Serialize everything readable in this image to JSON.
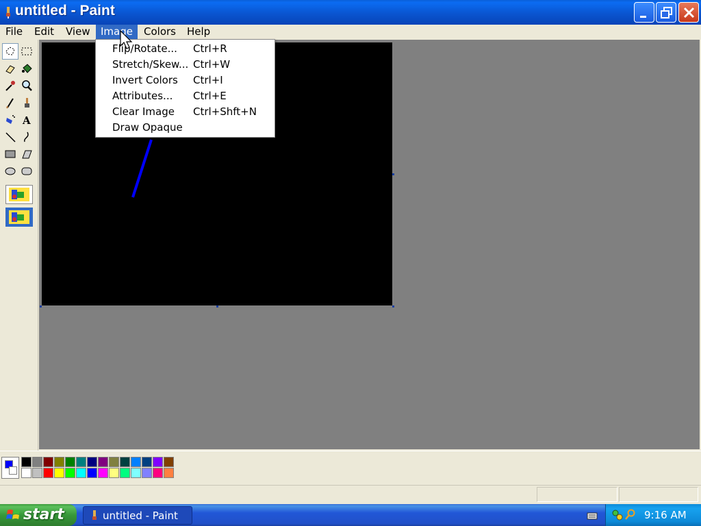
{
  "window": {
    "title": "untitled - Paint"
  },
  "menubar": {
    "items": [
      {
        "id": "file",
        "label": "File"
      },
      {
        "id": "edit",
        "label": "Edit"
      },
      {
        "id": "view",
        "label": "View"
      },
      {
        "id": "image",
        "label": "Image",
        "active": true
      },
      {
        "id": "colors",
        "label": "Colors"
      },
      {
        "id": "help",
        "label": "Help"
      }
    ]
  },
  "image_menu": {
    "items": [
      {
        "label": "Flip/Rotate...",
        "shortcut": "Ctrl+R"
      },
      {
        "label": "Stretch/Skew...",
        "shortcut": "Ctrl+W"
      },
      {
        "label": "Invert Colors",
        "shortcut": "Ctrl+I"
      },
      {
        "label": "Attributes...",
        "shortcut": "Ctrl+E"
      },
      {
        "label": "Clear Image",
        "shortcut": "Ctrl+Shft+N"
      },
      {
        "label": "Draw Opaque",
        "shortcut": ""
      }
    ]
  },
  "toolbox": {
    "tools": [
      "free-form-select-icon",
      "select-icon",
      "eraser-icon",
      "fill-bucket-icon",
      "color-picker-icon",
      "magnifier-icon",
      "pencil-icon",
      "brush-icon",
      "airbrush-icon",
      "text-icon",
      "line-icon",
      "curve-icon",
      "rectangle-icon",
      "polygon-icon",
      "ellipse-icon",
      "rounded-rectangle-icon"
    ],
    "selected_tool": "free-form-select-icon"
  },
  "canvas": {
    "background": "#000000",
    "stroke_color": "#0000ff"
  },
  "colors": {
    "foreground": "#0000ff",
    "background": "#ffffff",
    "palette_top": [
      "#000000",
      "#808080",
      "#800000",
      "#808000",
      "#008000",
      "#008080",
      "#000080",
      "#800080",
      "#808040",
      "#004040",
      "#0080ff",
      "#004080",
      "#8000ff",
      "#804000"
    ],
    "palette_bottom": [
      "#ffffff",
      "#c0c0c0",
      "#ff0000",
      "#ffff00",
      "#00ff00",
      "#00ffff",
      "#0000ff",
      "#ff00ff",
      "#ffff80",
      "#00ff80",
      "#80ffff",
      "#8080ff",
      "#ff0080",
      "#ff8040"
    ]
  },
  "taskbar": {
    "start_label": "start",
    "task_label": "untitled - Paint",
    "clock": "9:16 AM"
  }
}
